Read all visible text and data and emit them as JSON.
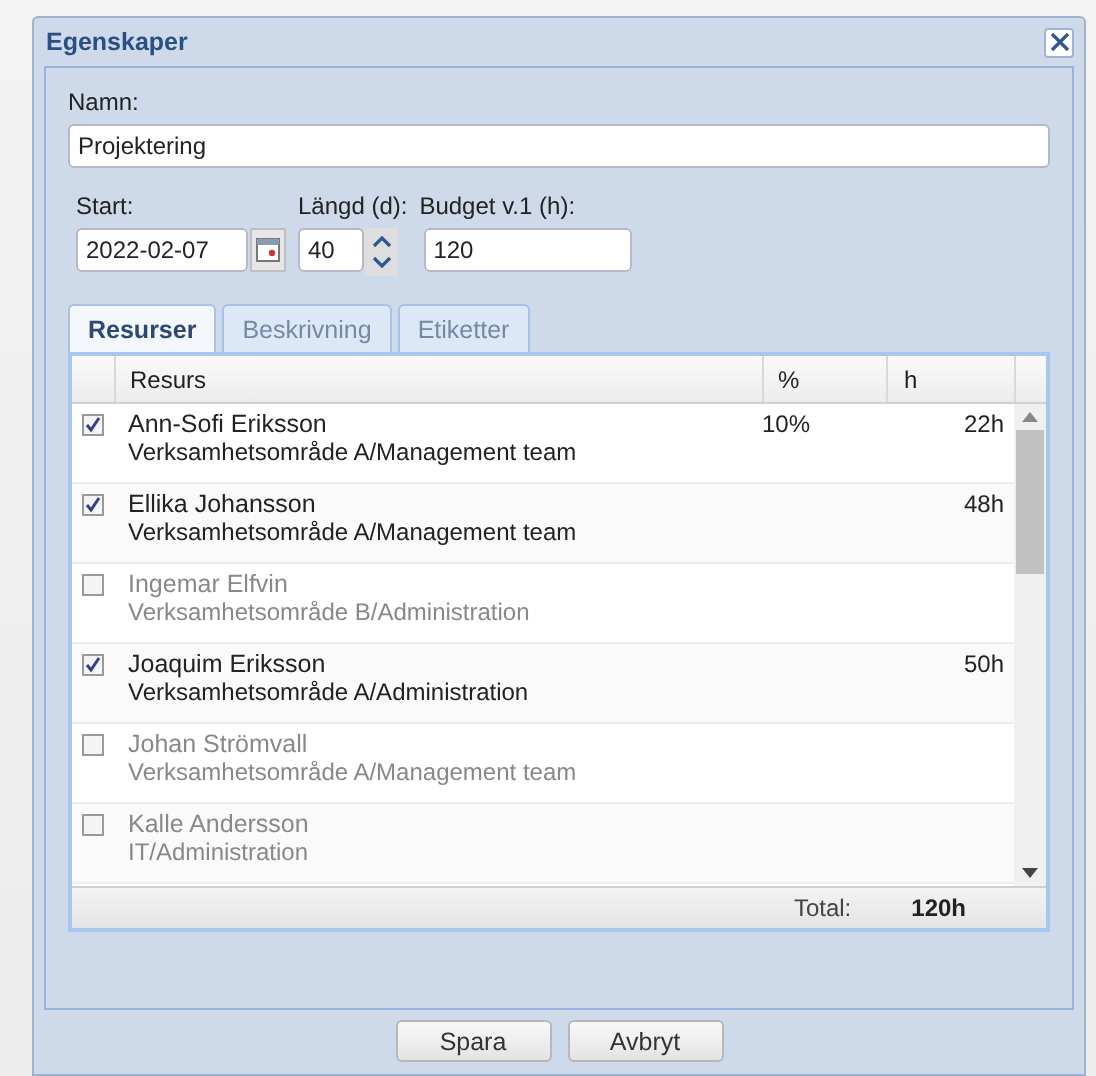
{
  "dialog": {
    "title": "Egenskaper"
  },
  "name": {
    "label": "Namn:",
    "value": "Projektering"
  },
  "start": {
    "label": "Start:",
    "value": "2022-02-07"
  },
  "length": {
    "label": "Längd (d):",
    "value": "40"
  },
  "budget": {
    "label": "Budget v.1 (h):",
    "value": "120"
  },
  "tabs": [
    {
      "label": "Resurser",
      "selected": true
    },
    {
      "label": "Beskrivning",
      "selected": false
    },
    {
      "label": "Etiketter",
      "selected": false
    }
  ],
  "table": {
    "columns": [
      "Resurs",
      "%",
      "h"
    ],
    "rows": [
      {
        "checked": true,
        "name": "Ann-Sofi Eriksson",
        "group": "Verksamhetsområde A/Management team",
        "percent": "10%",
        "hours": "22h"
      },
      {
        "checked": true,
        "name": "Ellika Johansson",
        "group": "Verksamhetsområde A/Management team",
        "hours": "48h"
      },
      {
        "checked": false,
        "name": "Ingemar Elfvin",
        "group": "Verksamhetsområde B/Administration"
      },
      {
        "checked": true,
        "name": "Joaquim Eriksson",
        "group": "Verksamhetsområde A/Administration",
        "hours": "50h"
      },
      {
        "checked": false,
        "name": "Johan Strömvall",
        "group": "Verksamhetsområde A/Management team"
      },
      {
        "checked": false,
        "name": "Kalle Andersson",
        "group": "IT/Administration"
      }
    ],
    "total_label": "Total:",
    "total": "120h"
  },
  "buttons": [
    "Spara",
    "Avbryt"
  ]
}
